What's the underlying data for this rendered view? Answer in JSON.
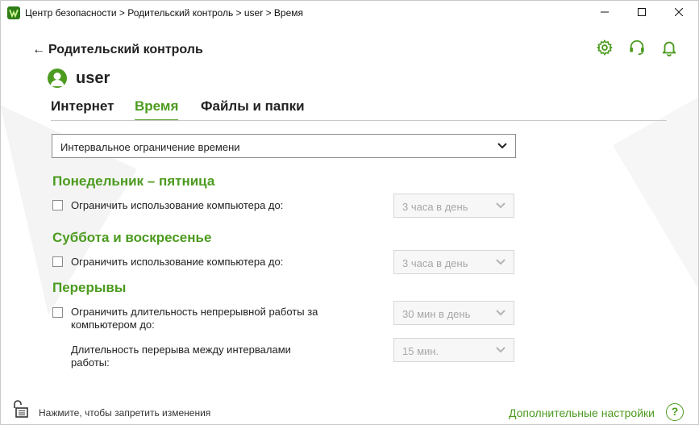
{
  "window": {
    "title": "Центр безопасности > Родительский контроль > user > Время"
  },
  "header": {
    "back_label": "Родительский контроль",
    "user_name": "user",
    "icons": [
      "gear-icon",
      "headset-icon",
      "bell-icon"
    ]
  },
  "tabs": [
    {
      "label": "Интернет",
      "active": false
    },
    {
      "label": "Время",
      "active": true
    },
    {
      "label": "Файлы и папки",
      "active": false
    }
  ],
  "mode_select": {
    "value": "Интервальное ограничение времени"
  },
  "weekdays": {
    "title": "Понедельник – пятница",
    "checkbox_label": "Ограничить использование компьютера до:",
    "checked": false,
    "limit_value": "3 часа в день"
  },
  "weekend": {
    "title": "Суббота и воскресенье",
    "checkbox_label": "Ограничить использование компьютера до:",
    "checked": false,
    "limit_value": "3 часа в день"
  },
  "breaks": {
    "title": "Перерывы",
    "continuous_label_line1": "Ограничить длительность непрерывной работы за",
    "continuous_label_line2": "компьютером до:",
    "checked": false,
    "continuous_value": "30 мин в день",
    "break_label_line1": "Длительность перерыва между интервалами",
    "break_label_line2": "работы:",
    "break_value": "15 мин."
  },
  "footer": {
    "lock_text": "Нажмите, чтобы запретить изменения",
    "more_settings": "Дополнительные настройки",
    "help": "?"
  },
  "colors": {
    "accent": "#4c9b1f",
    "disabled_text": "#a7a7a7"
  }
}
